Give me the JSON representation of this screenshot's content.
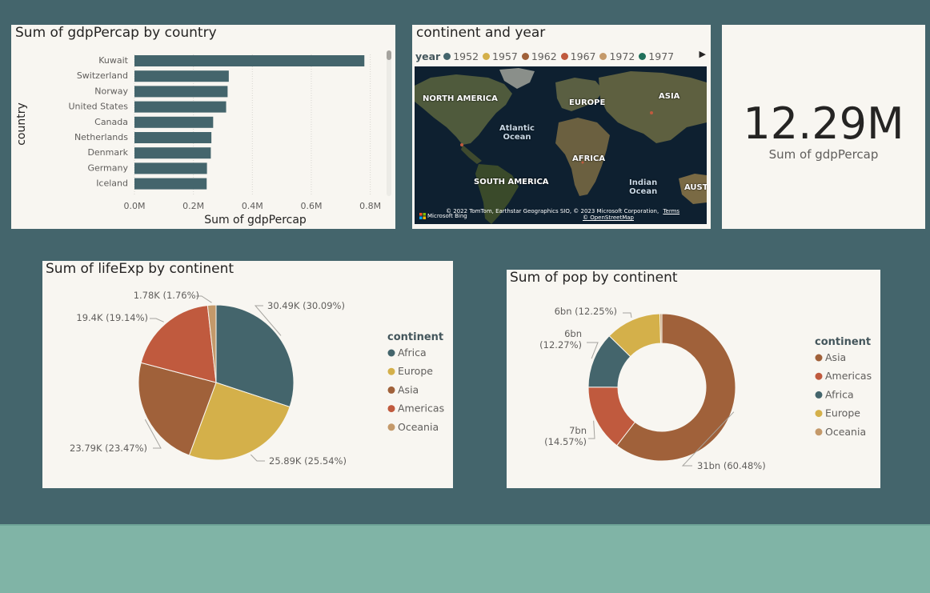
{
  "colors": {
    "background": "#44656c",
    "bottom_band": "#80b4a6",
    "panel": "#f8f6f1",
    "bar": "#44656c",
    "africa": "#44656c",
    "europe": "#d4b04a",
    "asia": "#a0613a",
    "americas": "#c05a3e",
    "oceania": "#c4996a"
  },
  "bar_chart": {
    "title": "Sum of gdpPercap by country"
  },
  "map_visual": {
    "title": "continent and year",
    "legend_title": "year",
    "legend_items": [
      {
        "label": "1952",
        "color": "#44656c"
      },
      {
        "label": "1957",
        "color": "#d4b04a"
      },
      {
        "label": "1962",
        "color": "#a0613a"
      },
      {
        "label": "1967",
        "color": "#c05a3e"
      },
      {
        "label": "1972",
        "color": "#c4996a"
      },
      {
        "label": "1977",
        "color": "#1f6f5a"
      }
    ],
    "labels": {
      "north_america": "NORTH AMERICA",
      "europe": "EUROPE",
      "asia": "ASIA",
      "atlantic_1": "Atlantic",
      "atlantic_2": "Ocean",
      "africa": "AFRICA",
      "south_america": "SOUTH AMERICA",
      "indian_1": "Indian",
      "indian_2": "Ocean",
      "australia": "AUSTI"
    },
    "attribution": "© 2022 TomTom, Earthstar Geographics SIO, © 2023 Microsoft Corporation,",
    "terms": "Terms",
    "osm": "© OpenStreetMap",
    "brand": "Microsoft Bing"
  },
  "card": {
    "value": "12.29M",
    "label": "Sum of gdpPercap"
  },
  "chart_data": [
    {
      "type": "bar",
      "orientation": "horizontal",
      "title": "Sum of gdpPercap by country",
      "xlabel": "Sum of gdpPercap",
      "ylabel": "country",
      "categories": [
        "Kuwait",
        "Switzerland",
        "Norway",
        "United States",
        "Canada",
        "Netherlands",
        "Denmark",
        "Germany",
        "Iceland"
      ],
      "values": [
        780000,
        320000,
        316000,
        311000,
        267000,
        261000,
        259000,
        246000,
        245000
      ],
      "xticks": [
        "0.0M",
        "0.2M",
        "0.4M",
        "0.6M",
        "0.8M"
      ],
      "xlim": [
        0,
        0.82
      ],
      "grid": true
    },
    {
      "type": "pie",
      "title": "Sum of lifeExp by continent",
      "legend_title": "continent",
      "legend_position": "right",
      "slices": [
        {
          "label": "Africa",
          "value": 30.49,
          "display": "30.49K (30.09%)",
          "color": "#44656c"
        },
        {
          "label": "Europe",
          "value": 25.89,
          "display": "25.89K (25.54%)",
          "color": "#d4b04a"
        },
        {
          "label": "Asia",
          "value": 23.79,
          "display": "23.79K (23.47%)",
          "color": "#a0613a"
        },
        {
          "label": "Americas",
          "value": 19.4,
          "display": "19.4K (19.14%)",
          "color": "#c05a3e"
        },
        {
          "label": "Oceania",
          "value": 1.78,
          "display": "1.78K (1.76%)",
          "color": "#c4996a"
        }
      ]
    },
    {
      "type": "pie",
      "subtype": "donut",
      "title": "Sum of pop by continent",
      "legend_title": "continent",
      "legend_position": "right",
      "slices": [
        {
          "label": "Asia",
          "value": 60.48,
          "display": "31bn (60.48%)",
          "color": "#a0613a"
        },
        {
          "label": "Americas",
          "value": 14.57,
          "display": "7bn (14.57%)",
          "color": "#c05a3e"
        },
        {
          "label": "Africa",
          "value": 12.27,
          "display": "6bn (12.27%)",
          "color": "#44656c"
        },
        {
          "label": "Europe",
          "value": 12.25,
          "display": "6bn (12.25%)",
          "color": "#d4b04a"
        },
        {
          "label": "Oceania",
          "value": 0.43,
          "display": "",
          "color": "#c4996a"
        }
      ]
    }
  ]
}
